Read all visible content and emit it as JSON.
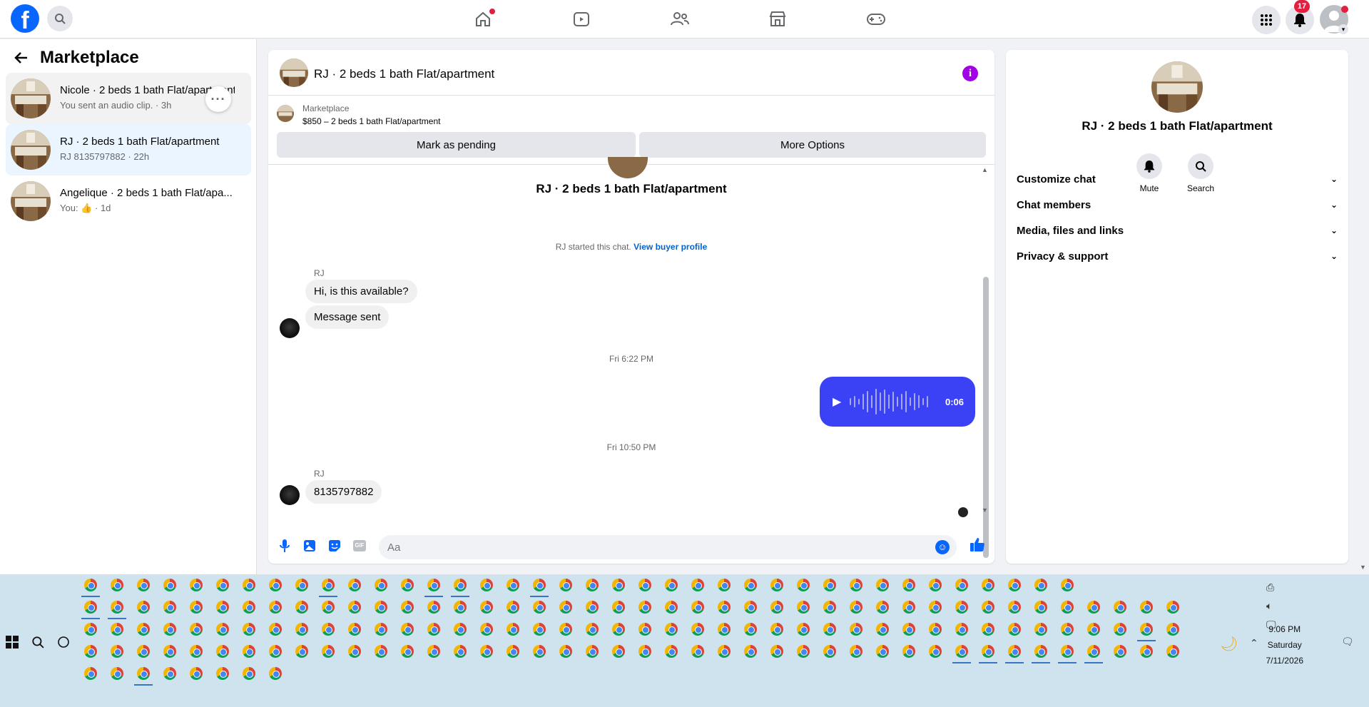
{
  "topbar": {
    "logo": "f",
    "notifications_count": "17"
  },
  "left": {
    "title": "Marketplace",
    "conversations": [
      {
        "name": "Nicole · 2 beds 1 bath Flat/apartment",
        "sub": "You sent an audio clip. · 3h"
      },
      {
        "name": "RJ · 2 beds 1 bath Flat/apartment",
        "sub": "RJ 8135797882 · 22h"
      },
      {
        "name": "Angelique · 2 beds 1 bath Flat/apa...",
        "sub_prefix": "You:",
        "sub_suffix": "· 1d"
      }
    ]
  },
  "chat": {
    "title": "RJ · 2 beds 1 bath Flat/apartment",
    "listing_label": "Marketplace",
    "listing_price": "$850 – 2 beds 1 bath Flat/apartment",
    "mark_pending": "Mark as pending",
    "more_options": "More Options",
    "thread_title": "RJ · 2 beds 1 bath Flat/apartment",
    "started_text": "RJ started this chat.",
    "view_buyer": "View buyer profile",
    "sender1": "RJ",
    "msg1": "Hi, is this available?",
    "msg2": "Message sent",
    "time1": "Fri 6:22 PM",
    "audio_duration": "0:06",
    "time2": "Fri 10:50 PM",
    "sender2": "RJ",
    "msg3": "8135797882",
    "input_placeholder": "Aa"
  },
  "right": {
    "title": "RJ · 2 beds 1 bath Flat/apartment",
    "mute": "Mute",
    "search": "Search",
    "sections": [
      "Customize chat",
      "Chat members",
      "Media, files and links",
      "Privacy & support"
    ]
  },
  "taskbar": {
    "time": "9:06 PM",
    "day": "Saturday",
    "date": "7/11/2026"
  },
  "colors": {
    "brand": "#0866ff",
    "audio_bubble": "#3b41f5",
    "info": "#a200e6",
    "badge": "#e41e3f"
  }
}
